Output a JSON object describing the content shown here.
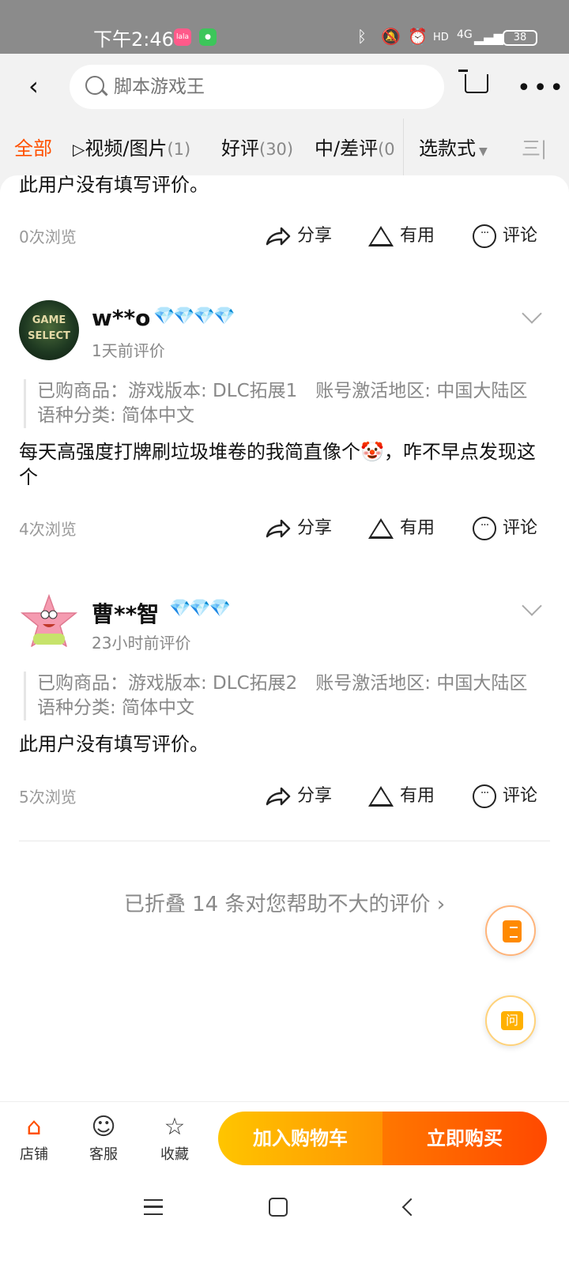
{
  "status": {
    "time": "下午2:46",
    "apps": [
      "lala",
      "wechat"
    ],
    "network": "4G",
    "battery": "38"
  },
  "header": {
    "search_placeholder": "脚本游戏王"
  },
  "tabs": [
    {
      "label": "全部",
      "count": ""
    },
    {
      "label": "视频/图片",
      "count": "(1)"
    },
    {
      "label": "好评",
      "count": "(30)"
    },
    {
      "label": "中/差评",
      "count": "(0"
    }
  ],
  "style_select": "选款式",
  "list_icon": "三|",
  "reviews": [
    {
      "text": "此用户没有填写评价。",
      "views": "0次浏览"
    },
    {
      "user": "w**o",
      "diamonds": "💎💎💎💎",
      "time": "1天前评价",
      "avatar_text": "GAME SELECT",
      "sku": "已购商品：游戏版本: DLC拓展1　账号激活地区: 中国大陆区　语种分类: 简体中文",
      "text": "每天高强度打牌刷垃圾堆卷的我简直像个🤡，咋不早点发现这个",
      "views": "4次浏览"
    },
    {
      "user": "曹**智",
      "diamonds": "💎💎💎",
      "time": "23小时前评价",
      "sku": "已购商品：游戏版本: DLC拓展2　账号激活地区: 中国大陆区　语种分类: 简体中文",
      "text": "此用户没有填写评价。",
      "views": "5次浏览"
    }
  ],
  "actions": {
    "share": "分享",
    "useful": "有用",
    "comment": "评论"
  },
  "folded": "已折叠 14 条对您帮助不大的评价",
  "fab_ask": "问",
  "bottom": {
    "store": "店铺",
    "service": "客服",
    "favorite": "收藏",
    "add_cart": "加入购物车",
    "buy_now": "立即购买"
  },
  "colors": {
    "accent": "#ff5000",
    "cart_button": "#ffb000",
    "buy_button": "#ff5a00",
    "diamond": "#35a7f5"
  }
}
